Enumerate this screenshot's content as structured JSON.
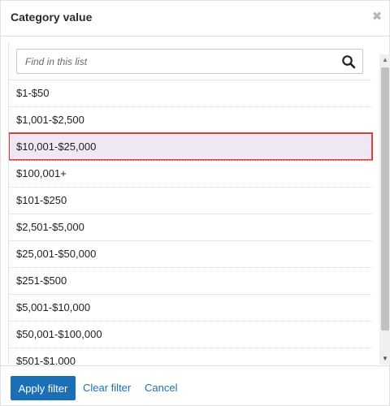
{
  "dialog": {
    "title": "Category value",
    "close_icon": "close-icon"
  },
  "search": {
    "placeholder": "Find in this list",
    "value": "",
    "icon": "search-icon"
  },
  "items": [
    {
      "label": "$1-$50",
      "selected": false
    },
    {
      "label": "$1,001-$2,500",
      "selected": false
    },
    {
      "label": "$10,001-$25,000",
      "selected": true
    },
    {
      "label": "$100,001+",
      "selected": false
    },
    {
      "label": "$101-$250",
      "selected": false
    },
    {
      "label": "$2,501-$5,000",
      "selected": false
    },
    {
      "label": "$25,001-$50,000",
      "selected": false
    },
    {
      "label": "$251-$500",
      "selected": false
    },
    {
      "label": "$5,001-$10,000",
      "selected": false
    },
    {
      "label": "$50,001-$100,000",
      "selected": false
    },
    {
      "label": "$501-$1,000",
      "selected": false
    }
  ],
  "footer": {
    "apply_label": "Apply filter",
    "clear_label": "Clear filter",
    "cancel_label": "Cancel"
  },
  "colors": {
    "primary": "#1a6fb6",
    "selected_bg": "#efe8f4",
    "highlight_border": "#e03e3e"
  }
}
